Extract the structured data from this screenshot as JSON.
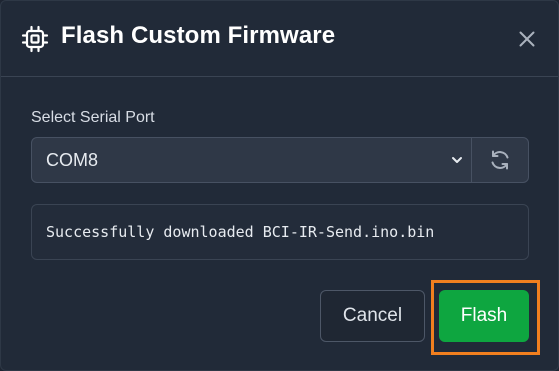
{
  "dialog": {
    "title": "Flash Custom Firmware",
    "header_icon": "chip-icon",
    "close_icon": "close-icon"
  },
  "serial_port": {
    "label": "Select Serial Port",
    "selected": "COM8",
    "chevron_icon": "chevron-down-icon",
    "refresh_icon": "refresh-icon"
  },
  "status": {
    "message": "Successfully downloaded BCI-IR-Send.ino.bin"
  },
  "actions": {
    "cancel_label": "Cancel",
    "flash_label": "Flash"
  },
  "colors": {
    "background": "#212a38",
    "flash_button": "#0ea640",
    "highlight": "#f17f1f"
  }
}
